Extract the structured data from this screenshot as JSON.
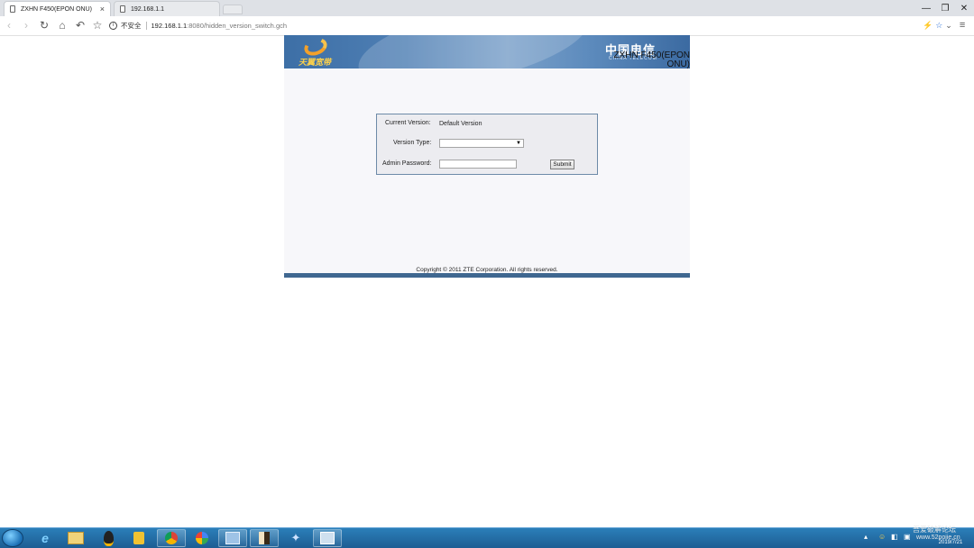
{
  "browser": {
    "tabs": [
      {
        "title": "ZXHN F450(EPON ONU)",
        "close": "×"
      },
      {
        "title": "192.168.1.1"
      }
    ],
    "window_controls": {
      "minimize": "—",
      "restore": "❐",
      "close": "✕"
    },
    "nav": {
      "back": "‹",
      "forward": "›",
      "reload": "↻",
      "home": "⌂",
      "undo": "↶",
      "bookmark": "☆"
    },
    "address": {
      "security_label": "不安全",
      "url_host": "192.168.1.1",
      "url_path": ":8080/hidden_version_switch.gch"
    },
    "right_icons": {
      "lightning": "⚡",
      "star": "☆",
      "chevron": "⌄",
      "menu": "≡"
    }
  },
  "router_page": {
    "banner": {
      "left_brand": "天翼宽带",
      "right_brand": "中国电信",
      "right_brand_sub": "CHINA TELECOM",
      "model_title": "ZXHN F450(EPON ONU)"
    },
    "form": {
      "current_version_label": "Current Version:",
      "current_version_value": "Default Version",
      "version_type_label": "Version Type:",
      "version_type_value": "",
      "admin_password_label": "Admin Password:",
      "admin_password_value": "",
      "submit_label": "Submit"
    },
    "copyright": "Copyright © 2011 ZTE Corporation. All rights reserved."
  },
  "taskbar": {
    "apps": [
      "ie-icon",
      "folder-icon",
      "qq-icon",
      "search-app-icon",
      "chrome-icon",
      "player-icon",
      "tool-icon",
      "book-icon",
      "pin-icon",
      "network-icon"
    ],
    "watermark_line1": "吾爱破解论坛",
    "watermark_line2": "www.52pojie.cn",
    "clock_date": "2019/7/21"
  },
  "colors": {
    "banner_blue": "#4f7fb4",
    "footer_bar": "#3f6790",
    "page_bg": "#f7f7fa",
    "taskbar": "#1d5d93"
  }
}
